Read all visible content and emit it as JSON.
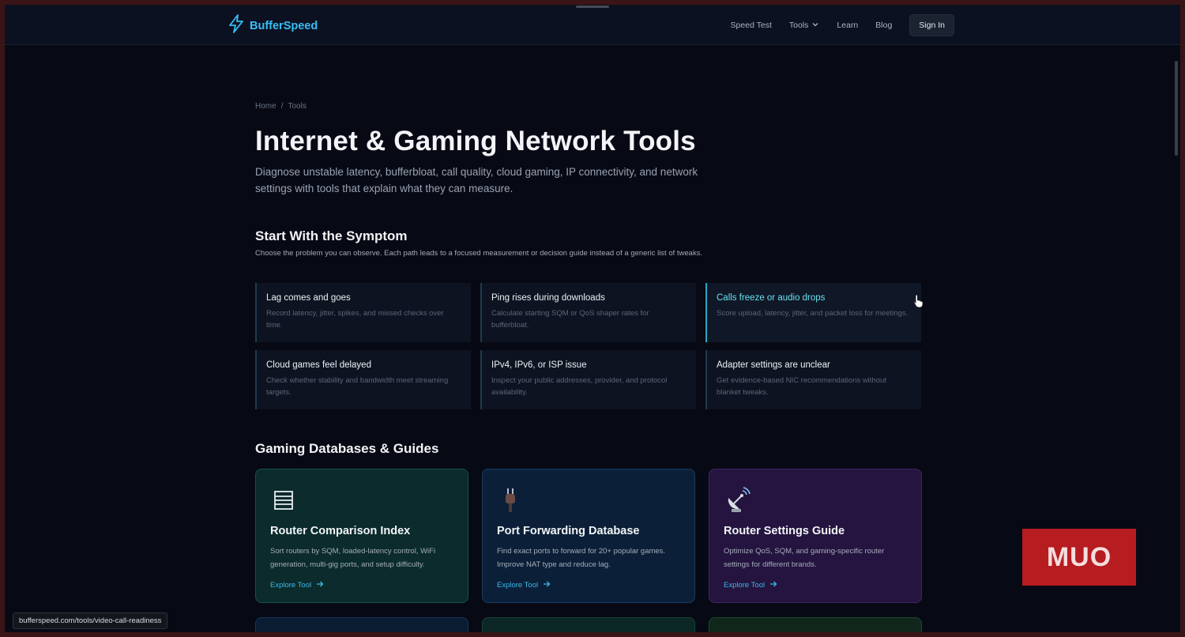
{
  "nav": {
    "brand": "BufferSpeed",
    "links": [
      "Speed Test",
      "Tools",
      "Learn",
      "Blog"
    ],
    "signin": "Sign In"
  },
  "breadcrumb": {
    "home": "Home",
    "sep": "/",
    "current": "Tools"
  },
  "hero": {
    "title": "Internet & Gaming Network Tools",
    "lead": "Diagnose unstable latency, bufferbloat, call quality, cloud gaming, IP connectivity, and network settings with tools that explain what they can measure."
  },
  "symptoms": {
    "heading": "Start With the Symptom",
    "sub": "Choose the problem you can observe. Each path leads to a focused measurement or decision guide instead of a generic list of tweaks.",
    "items": [
      {
        "title": "Lag comes and goes",
        "desc": "Record latency, jitter, spikes, and missed checks over time."
      },
      {
        "title": "Ping rises during downloads",
        "desc": "Calculate starting SQM or QoS shaper rates for bufferbloat."
      },
      {
        "title": "Calls freeze or audio drops",
        "desc": "Score upload, latency, jitter, and packet loss for meetings."
      },
      {
        "title": "Cloud games feel delayed",
        "desc": "Check whether stability and bandwidth meet streaming targets."
      },
      {
        "title": "IPv4, IPv6, or ISP issue",
        "desc": "Inspect your public addresses, provider, and protocol availability."
      },
      {
        "title": "Adapter settings are unclear",
        "desc": "Get evidence-based NIC recommendations without blanket tweaks."
      }
    ]
  },
  "guides": {
    "heading": "Gaming Databases & Guides",
    "cards": [
      {
        "title": "Router Comparison Index",
        "desc": "Sort routers by SQM, loaded-latency control, WiFi generation, multi-gig ports, and setup difficulty.",
        "link": "Explore Tool",
        "icon": "list-icon"
      },
      {
        "title": "Port Forwarding Database",
        "desc": "Find exact ports to forward for 20+ popular games. Improve NAT type and reduce lag.",
        "link": "Explore Tool",
        "icon": "plug-icon"
      },
      {
        "title": "Router Settings Guide",
        "desc": "Optimize QoS, SQM, and gaming-specific router settings for different brands.",
        "link": "Explore Tool",
        "icon": "satellite-icon"
      }
    ]
  },
  "status_url": "bufferspeed.com/tools/video-call-readiness",
  "watermark": "MUO",
  "colors": {
    "accent": "#38bdf8",
    "active": "#67e0ef",
    "background": "#070a14",
    "watermark": "#b71c20"
  }
}
